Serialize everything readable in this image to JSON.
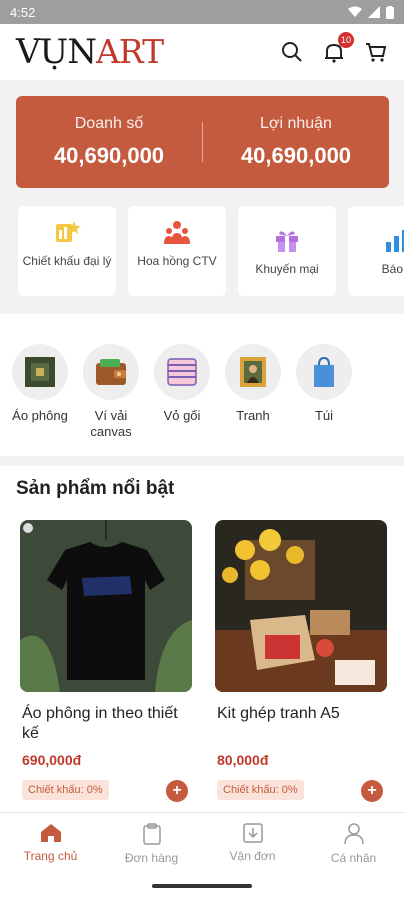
{
  "status": {
    "time": "4:52"
  },
  "header": {
    "logo_left": "VỤN",
    "logo_right": "ART",
    "notifications": "10"
  },
  "summary": {
    "sales_label": "Doanh số",
    "sales_value": "40,690,000",
    "profit_label": "Lợi nhuận",
    "profit_value": "40,690,000"
  },
  "quick_actions": [
    {
      "label": "Chiết khấu đại lý",
      "icon": "agent-discount-icon"
    },
    {
      "label": "Hoa hồng CTV",
      "icon": "commission-icon"
    },
    {
      "label": "Khuyến mại",
      "icon": "gift-icon"
    },
    {
      "label": "Báo c",
      "icon": "report-chart-icon"
    }
  ],
  "categories": [
    {
      "label": "Áo phông"
    },
    {
      "label": "Ví vải canvas"
    },
    {
      "label": "Vỏ gối"
    },
    {
      "label": "Tranh"
    },
    {
      "label": "Túi"
    }
  ],
  "featured": {
    "title": "Sản phẩm nổi bật",
    "products": [
      {
        "name": "Áo phông in theo thiết kế",
        "price": "690,000đ",
        "discount": "Chiết khấu: 0%"
      },
      {
        "name": "Kit ghép tranh A5",
        "price": "80,000đ",
        "discount": "Chiết khấu: 0%"
      }
    ]
  },
  "nav": [
    {
      "label": "Trang chủ",
      "active": true
    },
    {
      "label": "Đơn hàng"
    },
    {
      "label": "Vận đơn"
    },
    {
      "label": "Cá nhân"
    }
  ],
  "colors": {
    "accent": "#c45b3e"
  }
}
